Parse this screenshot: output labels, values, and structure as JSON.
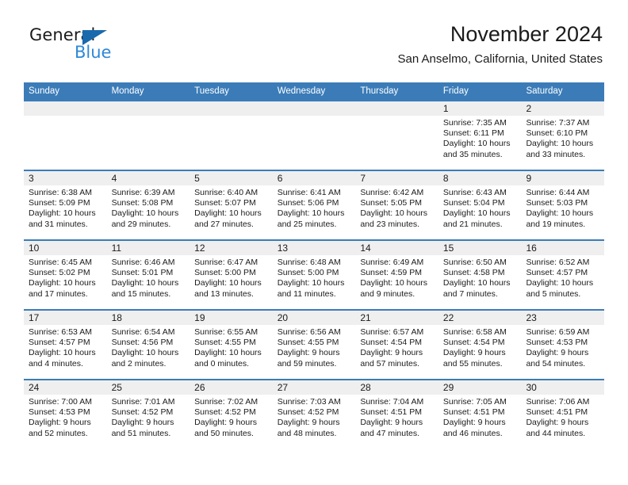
{
  "brand": {
    "name_part1": "General",
    "name_part2": "Blue",
    "triangle_icon": "triangle-icon",
    "accent_blue": "#2f88d6",
    "logo_triangle_blue": "#1a69ad"
  },
  "header": {
    "month_title": "November 2024",
    "location": "San Anselmo, California, United States",
    "header_blue": "#3b7cb8",
    "daynum_band_gray": "#efefef"
  },
  "calendar": {
    "weekday_headers": [
      "Sunday",
      "Monday",
      "Tuesday",
      "Wednesday",
      "Thursday",
      "Friday",
      "Saturday"
    ],
    "weeks": [
      [
        {
          "day": "",
          "sunrise": "",
          "sunset": "",
          "daylight_line1": "",
          "daylight_line2": ""
        },
        {
          "day": "",
          "sunrise": "",
          "sunset": "",
          "daylight_line1": "",
          "daylight_line2": ""
        },
        {
          "day": "",
          "sunrise": "",
          "sunset": "",
          "daylight_line1": "",
          "daylight_line2": ""
        },
        {
          "day": "",
          "sunrise": "",
          "sunset": "",
          "daylight_line1": "",
          "daylight_line2": ""
        },
        {
          "day": "",
          "sunrise": "",
          "sunset": "",
          "daylight_line1": "",
          "daylight_line2": ""
        },
        {
          "day": "1",
          "sunrise": "Sunrise: 7:35 AM",
          "sunset": "Sunset: 6:11 PM",
          "daylight_line1": "Daylight: 10 hours",
          "daylight_line2": "and 35 minutes."
        },
        {
          "day": "2",
          "sunrise": "Sunrise: 7:37 AM",
          "sunset": "Sunset: 6:10 PM",
          "daylight_line1": "Daylight: 10 hours",
          "daylight_line2": "and 33 minutes."
        }
      ],
      [
        {
          "day": "3",
          "sunrise": "Sunrise: 6:38 AM",
          "sunset": "Sunset: 5:09 PM",
          "daylight_line1": "Daylight: 10 hours",
          "daylight_line2": "and 31 minutes."
        },
        {
          "day": "4",
          "sunrise": "Sunrise: 6:39 AM",
          "sunset": "Sunset: 5:08 PM",
          "daylight_line1": "Daylight: 10 hours",
          "daylight_line2": "and 29 minutes."
        },
        {
          "day": "5",
          "sunrise": "Sunrise: 6:40 AM",
          "sunset": "Sunset: 5:07 PM",
          "daylight_line1": "Daylight: 10 hours",
          "daylight_line2": "and 27 minutes."
        },
        {
          "day": "6",
          "sunrise": "Sunrise: 6:41 AM",
          "sunset": "Sunset: 5:06 PM",
          "daylight_line1": "Daylight: 10 hours",
          "daylight_line2": "and 25 minutes."
        },
        {
          "day": "7",
          "sunrise": "Sunrise: 6:42 AM",
          "sunset": "Sunset: 5:05 PM",
          "daylight_line1": "Daylight: 10 hours",
          "daylight_line2": "and 23 minutes."
        },
        {
          "day": "8",
          "sunrise": "Sunrise: 6:43 AM",
          "sunset": "Sunset: 5:04 PM",
          "daylight_line1": "Daylight: 10 hours",
          "daylight_line2": "and 21 minutes."
        },
        {
          "day": "9",
          "sunrise": "Sunrise: 6:44 AM",
          "sunset": "Sunset: 5:03 PM",
          "daylight_line1": "Daylight: 10 hours",
          "daylight_line2": "and 19 minutes."
        }
      ],
      [
        {
          "day": "10",
          "sunrise": "Sunrise: 6:45 AM",
          "sunset": "Sunset: 5:02 PM",
          "daylight_line1": "Daylight: 10 hours",
          "daylight_line2": "and 17 minutes."
        },
        {
          "day": "11",
          "sunrise": "Sunrise: 6:46 AM",
          "sunset": "Sunset: 5:01 PM",
          "daylight_line1": "Daylight: 10 hours",
          "daylight_line2": "and 15 minutes."
        },
        {
          "day": "12",
          "sunrise": "Sunrise: 6:47 AM",
          "sunset": "Sunset: 5:00 PM",
          "daylight_line1": "Daylight: 10 hours",
          "daylight_line2": "and 13 minutes."
        },
        {
          "day": "13",
          "sunrise": "Sunrise: 6:48 AM",
          "sunset": "Sunset: 5:00 PM",
          "daylight_line1": "Daylight: 10 hours",
          "daylight_line2": "and 11 minutes."
        },
        {
          "day": "14",
          "sunrise": "Sunrise: 6:49 AM",
          "sunset": "Sunset: 4:59 PM",
          "daylight_line1": "Daylight: 10 hours",
          "daylight_line2": "and 9 minutes."
        },
        {
          "day": "15",
          "sunrise": "Sunrise: 6:50 AM",
          "sunset": "Sunset: 4:58 PM",
          "daylight_line1": "Daylight: 10 hours",
          "daylight_line2": "and 7 minutes."
        },
        {
          "day": "16",
          "sunrise": "Sunrise: 6:52 AM",
          "sunset": "Sunset: 4:57 PM",
          "daylight_line1": "Daylight: 10 hours",
          "daylight_line2": "and 5 minutes."
        }
      ],
      [
        {
          "day": "17",
          "sunrise": "Sunrise: 6:53 AM",
          "sunset": "Sunset: 4:57 PM",
          "daylight_line1": "Daylight: 10 hours",
          "daylight_line2": "and 4 minutes."
        },
        {
          "day": "18",
          "sunrise": "Sunrise: 6:54 AM",
          "sunset": "Sunset: 4:56 PM",
          "daylight_line1": "Daylight: 10 hours",
          "daylight_line2": "and 2 minutes."
        },
        {
          "day": "19",
          "sunrise": "Sunrise: 6:55 AM",
          "sunset": "Sunset: 4:55 PM",
          "daylight_line1": "Daylight: 10 hours",
          "daylight_line2": "and 0 minutes."
        },
        {
          "day": "20",
          "sunrise": "Sunrise: 6:56 AM",
          "sunset": "Sunset: 4:55 PM",
          "daylight_line1": "Daylight: 9 hours",
          "daylight_line2": "and 59 minutes."
        },
        {
          "day": "21",
          "sunrise": "Sunrise: 6:57 AM",
          "sunset": "Sunset: 4:54 PM",
          "daylight_line1": "Daylight: 9 hours",
          "daylight_line2": "and 57 minutes."
        },
        {
          "day": "22",
          "sunrise": "Sunrise: 6:58 AM",
          "sunset": "Sunset: 4:54 PM",
          "daylight_line1": "Daylight: 9 hours",
          "daylight_line2": "and 55 minutes."
        },
        {
          "day": "23",
          "sunrise": "Sunrise: 6:59 AM",
          "sunset": "Sunset: 4:53 PM",
          "daylight_line1": "Daylight: 9 hours",
          "daylight_line2": "and 54 minutes."
        }
      ],
      [
        {
          "day": "24",
          "sunrise": "Sunrise: 7:00 AM",
          "sunset": "Sunset: 4:53 PM",
          "daylight_line1": "Daylight: 9 hours",
          "daylight_line2": "and 52 minutes."
        },
        {
          "day": "25",
          "sunrise": "Sunrise: 7:01 AM",
          "sunset": "Sunset: 4:52 PM",
          "daylight_line1": "Daylight: 9 hours",
          "daylight_line2": "and 51 minutes."
        },
        {
          "day": "26",
          "sunrise": "Sunrise: 7:02 AM",
          "sunset": "Sunset: 4:52 PM",
          "daylight_line1": "Daylight: 9 hours",
          "daylight_line2": "and 50 minutes."
        },
        {
          "day": "27",
          "sunrise": "Sunrise: 7:03 AM",
          "sunset": "Sunset: 4:52 PM",
          "daylight_line1": "Daylight: 9 hours",
          "daylight_line2": "and 48 minutes."
        },
        {
          "day": "28",
          "sunrise": "Sunrise: 7:04 AM",
          "sunset": "Sunset: 4:51 PM",
          "daylight_line1": "Daylight: 9 hours",
          "daylight_line2": "and 47 minutes."
        },
        {
          "day": "29",
          "sunrise": "Sunrise: 7:05 AM",
          "sunset": "Sunset: 4:51 PM",
          "daylight_line1": "Daylight: 9 hours",
          "daylight_line2": "and 46 minutes."
        },
        {
          "day": "30",
          "sunrise": "Sunrise: 7:06 AM",
          "sunset": "Sunset: 4:51 PM",
          "daylight_line1": "Daylight: 9 hours",
          "daylight_line2": "and 44 minutes."
        }
      ]
    ]
  }
}
